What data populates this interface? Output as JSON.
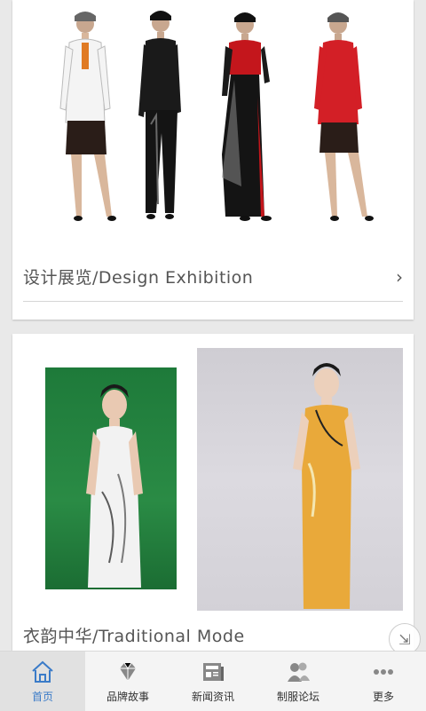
{
  "cards": [
    {
      "title": "设计展览/Design Exhibition",
      "has_chevron": true
    },
    {
      "title": "衣韵中华/Traditional Mode"
    }
  ],
  "chevron": "›",
  "bottom_nav": [
    {
      "label": "首页",
      "icon": "home-icon",
      "active": true
    },
    {
      "label": "品牌故事",
      "icon": "diamond-icon",
      "active": false
    },
    {
      "label": "新闻资讯",
      "icon": "newspaper-icon",
      "active": false
    },
    {
      "label": "制服论坛",
      "icon": "people-icon",
      "active": false
    },
    {
      "label": "更多",
      "icon": "more-icon",
      "active": false
    }
  ],
  "colors": {
    "accent": "#3a7bc8",
    "background": "#e9e9e9",
    "card": "#ffffff"
  }
}
